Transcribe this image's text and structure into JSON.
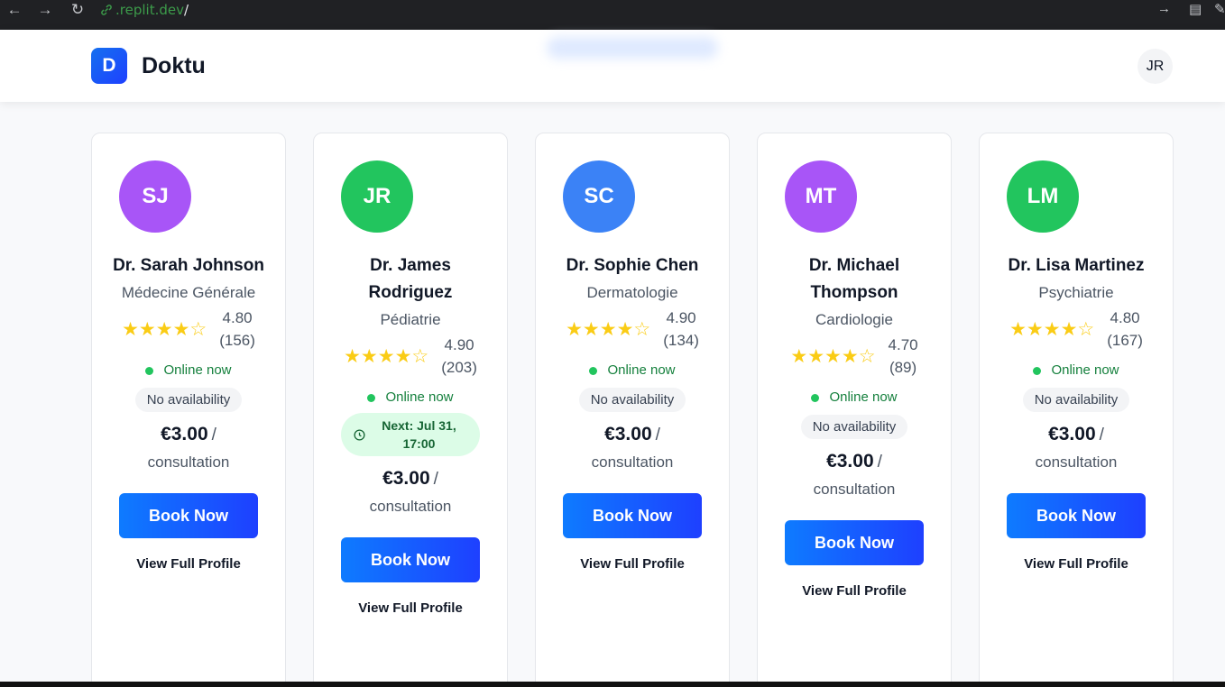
{
  "browser": {
    "url_host": ".replit.dev",
    "url_path": "/"
  },
  "header": {
    "logo_letter": "D",
    "brand": "Doktu",
    "user_initials": "JR"
  },
  "doctors": [
    {
      "initials": "SJ",
      "avatar_color": "#a855f7",
      "name": "Dr. Sarah Johnson",
      "specialty": "Médecine Générale",
      "stars": 4,
      "rating": "4.80",
      "reviews": "(156)",
      "online": "Online now",
      "availability": "No availability",
      "price": "€3.00",
      "price_sep": "/",
      "per": "consultation",
      "book": "Book Now",
      "profile": "View Full Profile"
    },
    {
      "initials": "JR",
      "avatar_color": "#22c55e",
      "name": "Dr. James Rodriguez",
      "specialty": "Pédiatrie",
      "stars": 4,
      "rating": "4.90",
      "reviews": "(203)",
      "online": "Online now",
      "next_slot": "Next: Jul 31, 17:00",
      "price": "€3.00",
      "price_sep": "/",
      "per": "consultation",
      "book": "Book Now",
      "profile": "View Full Profile"
    },
    {
      "initials": "SC",
      "avatar_color": "#3b82f6",
      "name": "Dr. Sophie Chen",
      "specialty": "Dermatologie",
      "stars": 4,
      "rating": "4.90",
      "reviews": "(134)",
      "online": "Online now",
      "availability": "No availability",
      "price": "€3.00",
      "price_sep": "/",
      "per": "consultation",
      "book": "Book Now",
      "profile": "View Full Profile"
    },
    {
      "initials": "MT",
      "avatar_color": "#a855f7",
      "name": "Dr. Michael Thompson",
      "specialty": "Cardiologie",
      "stars": 4,
      "rating": "4.70",
      "reviews": "(89)",
      "online": "Online now",
      "availability": "No availability",
      "price": "€3.00",
      "price_sep": "/",
      "per": "consultation",
      "book": "Book Now",
      "profile": "View Full Profile"
    },
    {
      "initials": "LM",
      "avatar_color": "#22c55e",
      "name": "Dr. Lisa Martinez",
      "specialty": "Psychiatrie",
      "stars": 4,
      "rating": "4.80",
      "reviews": "(167)",
      "online": "Online now",
      "availability": "No availability",
      "price": "€3.00",
      "price_sep": "/",
      "per": "consultation",
      "book": "Book Now",
      "profile": "View Full Profile"
    }
  ]
}
